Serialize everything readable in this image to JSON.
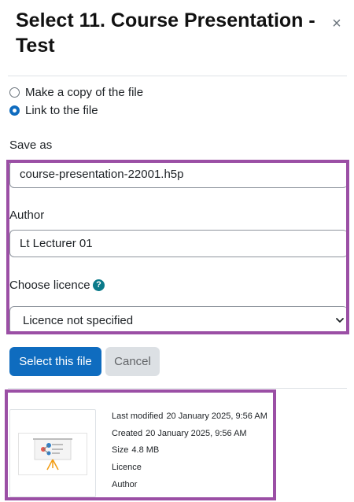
{
  "dialog": {
    "title": "Select 11. Course Presentation - Test",
    "close_symbol": "×"
  },
  "options": {
    "copy_label": "Make a copy of the file",
    "link_label": "Link to the file",
    "selected": "link"
  },
  "form": {
    "save_as_label": "Save as",
    "save_as_value": "course-presentation-22001.h5p",
    "author_label": "Author",
    "author_value": "Lt Lecturer 01",
    "licence_label": "Choose licence",
    "licence_value": "Licence not specified",
    "help_symbol": "?"
  },
  "buttons": {
    "select_label": "Select this file",
    "cancel_label": "Cancel"
  },
  "file_info": {
    "last_modified_label": "Last modified",
    "last_modified_value": "20 January 2025, 9:56 AM",
    "created_label": "Created",
    "created_value": "20 January 2025, 9:56 AM",
    "size_label": "Size",
    "size_value": "4.8 MB",
    "licence_label": "Licence",
    "author_label": "Author"
  },
  "colors": {
    "primary": "#0f6cbf",
    "highlight": "#9b4fa5",
    "help": "#0b7a8a"
  }
}
